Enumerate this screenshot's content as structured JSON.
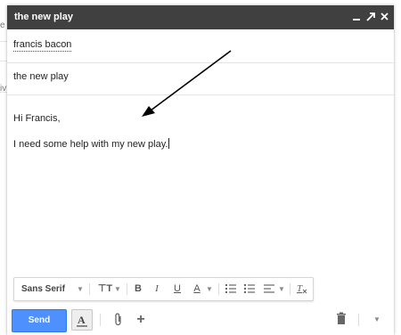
{
  "background": {
    "left_fragments": [
      "e",
      "iv"
    ]
  },
  "compose": {
    "window_title": "the new play",
    "to_value": "francis bacon",
    "subject_value": "the new play",
    "body_lines": [
      "Hi Francis,",
      "I need some help with my new play."
    ]
  },
  "format_toolbar": {
    "font": "Sans Serif",
    "font_size_icon": "font-size-icon",
    "bold": "B",
    "italic": "I",
    "underline": "U",
    "text_color": "A"
  },
  "bottom_bar": {
    "send_label": "Send"
  },
  "colors": {
    "titlebar": "#404040",
    "send_button": "#4d90fe",
    "spellcheck": "#d21a1a"
  }
}
